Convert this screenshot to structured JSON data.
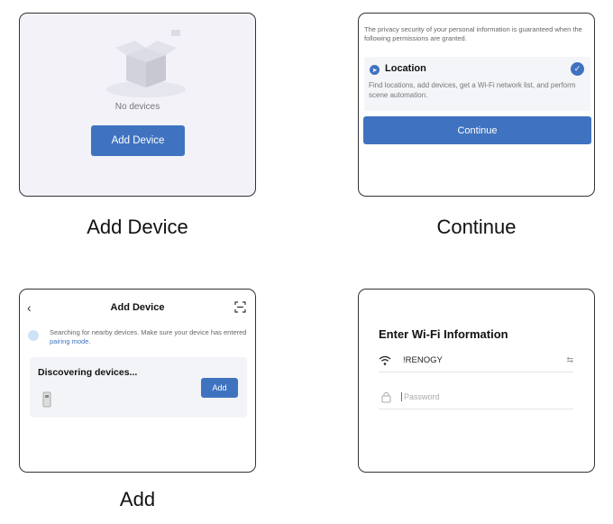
{
  "panel1": {
    "status_text": "No devices",
    "button_label": "Add Device",
    "caption": "Add Device"
  },
  "panel2": {
    "privacy_text": "The privacy security of your personal information is guaranteed when the following permissions are granted.",
    "permission_title": "Location",
    "permission_desc": "Find locations, add devices, get a Wi-Fi network list, and perform scene automation.",
    "button_label": "Continue",
    "caption": "Continue"
  },
  "panel3": {
    "back_glyph": "‹",
    "title": "Add Device",
    "info_text": "Searching for nearby devices. Make sure your device has entered ",
    "info_link": "pairing mode",
    "info_end": ".",
    "discovering": "Discovering devices...",
    "button_label": "Add",
    "caption": "Add"
  },
  "panel4": {
    "title": "Enter Wi-Fi Information",
    "ssid": "!RENOGY",
    "swap_glyph": "⇆",
    "password_placeholder": "Password"
  },
  "colors": {
    "accent": "#3f73c0",
    "panel1_bg": "#f2f2f8"
  }
}
